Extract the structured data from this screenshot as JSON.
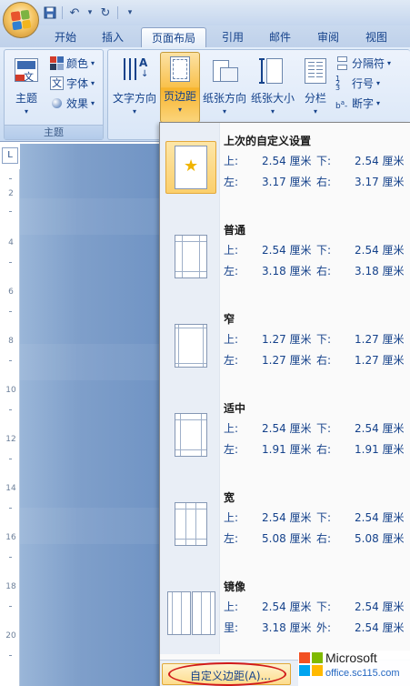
{
  "quick_access": {
    "undo_symbol": "↶",
    "redo_symbol": "↻",
    "save_icon": "save-icon",
    "customize_symbol": "▾"
  },
  "tabs": [
    {
      "label": "开始",
      "active": false
    },
    {
      "label": "插入",
      "active": false
    },
    {
      "label": "页面布局",
      "active": true
    },
    {
      "label": "引用",
      "active": false
    },
    {
      "label": "邮件",
      "active": false
    },
    {
      "label": "审阅",
      "active": false
    },
    {
      "label": "视图",
      "active": false
    }
  ],
  "ribbon": {
    "themes_group": {
      "label": "主题",
      "themes_button": "主题",
      "colors": "颜色",
      "fonts": "字体",
      "effects": "效果"
    },
    "page_setup": {
      "text_direction": "文字方向",
      "margins": "页边距",
      "orientation": "纸张方向",
      "size": "纸张大小",
      "columns": "分栏",
      "breaks": "分隔符",
      "line_numbers": "行号",
      "hyphenation": "断字"
    }
  },
  "ruler": {
    "corner_symbol": "L",
    "ticks": [
      "2",
      "4",
      "6",
      "8",
      "10",
      "12",
      "14",
      "16",
      "18",
      "20"
    ]
  },
  "margins_menu": {
    "presets": [
      {
        "name": "上次的自定义设置",
        "selected": true,
        "r1": [
          "上:",
          "2.54 厘米",
          "下:",
          "2.54 厘米"
        ],
        "r2": [
          "左:",
          "3.17 厘米",
          "右:",
          "3.17 厘米"
        ]
      },
      {
        "name": "普通",
        "selected": false,
        "r1": [
          "上:",
          "2.54 厘米",
          "下:",
          "2.54 厘米"
        ],
        "r2": [
          "左:",
          "3.18 厘米",
          "右:",
          "3.18 厘米"
        ]
      },
      {
        "name": "窄",
        "selected": false,
        "r1": [
          "上:",
          "1.27 厘米",
          "下:",
          "1.27 厘米"
        ],
        "r2": [
          "左:",
          "1.27 厘米",
          "右:",
          "1.27 厘米"
        ]
      },
      {
        "name": "适中",
        "selected": false,
        "r1": [
          "上:",
          "2.54 厘米",
          "下:",
          "2.54 厘米"
        ],
        "r2": [
          "左:",
          "1.91 厘米",
          "右:",
          "1.91 厘米"
        ]
      },
      {
        "name": "宽",
        "selected": false,
        "r1": [
          "上:",
          "2.54 厘米",
          "下:",
          "2.54 厘米"
        ],
        "r2": [
          "左:",
          "5.08 厘米",
          "右:",
          "5.08 厘米"
        ]
      },
      {
        "name": "镜像",
        "selected": false,
        "r1": [
          "上:",
          "2.54 厘米",
          "下:",
          "2.54 厘米"
        ],
        "r2": [
          "里:",
          "3.18 厘米",
          "外:",
          "2.54 厘米"
        ]
      }
    ],
    "custom_button": "自定义边距(A)..."
  },
  "watermark": {
    "brand": "Microsoft",
    "site": "office.sc115.com"
  },
  "colors": {
    "accent_orange": "#f9c14c",
    "annotation_red": "#d11a1a",
    "ribbon_text": "#15428b",
    "ms_red": "#f25022",
    "ms_green": "#7fba00",
    "ms_blue": "#00a4ef",
    "ms_yellow": "#ffb900"
  }
}
